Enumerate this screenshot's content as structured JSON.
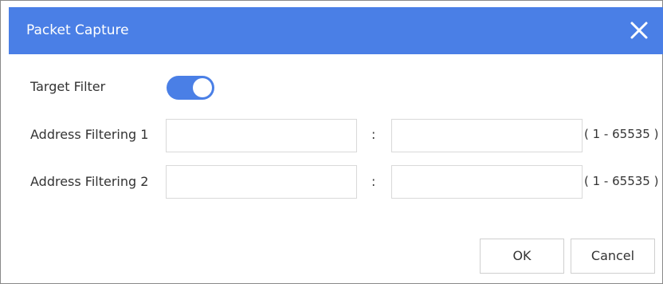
{
  "dialog": {
    "title": "Packet Capture",
    "close_icon": "close-icon",
    "accent_color": "#4a7fe6"
  },
  "target_filter": {
    "label": "Target Filter",
    "enabled": true
  },
  "address_filters": [
    {
      "label": "Address Filtering 1",
      "ip_value": "",
      "separator": ":",
      "port_value": "",
      "port_range": "( 1 - 65535 )"
    },
    {
      "label": "Address Filtering 2",
      "ip_value": "",
      "separator": ":",
      "port_value": "",
      "port_range": "( 1 - 65535 )"
    }
  ],
  "buttons": {
    "ok_label": "OK",
    "cancel_label": "Cancel"
  }
}
